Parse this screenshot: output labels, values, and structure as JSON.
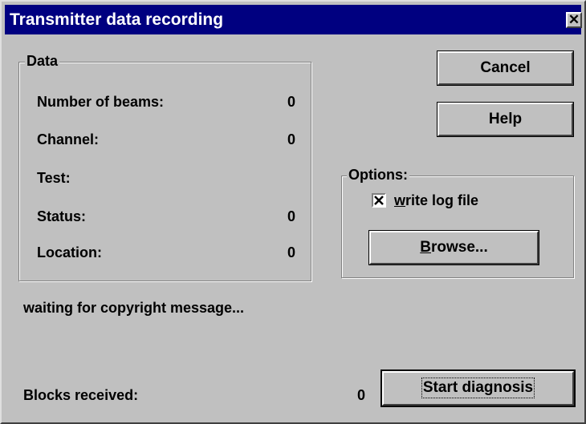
{
  "window": {
    "title": "Transmitter data recording",
    "close_glyph": "✕"
  },
  "data_group": {
    "label": "Data",
    "rows": [
      {
        "label": "Number of beams:",
        "value": "0"
      },
      {
        "label": "Channel:",
        "value": "0"
      },
      {
        "label": "Test:",
        "value": ""
      },
      {
        "label": "Status:",
        "value": "0"
      },
      {
        "label": "Location:",
        "value": "0"
      }
    ]
  },
  "status_message": "waiting for copyright message...",
  "blocks": {
    "label": "Blocks received:",
    "value": "0"
  },
  "buttons": {
    "cancel": "Cancel",
    "help": "Help",
    "browse_mnemonic": "B",
    "browse_rest": "rowse...",
    "start_diagnosis": "Start diagnosis"
  },
  "options_group": {
    "label": "Options:",
    "write_log_checked": true,
    "write_log_mnemonic": "w",
    "write_log_rest": "rite log file"
  },
  "colors": {
    "titlebar": "#000080",
    "face": "#c0c0c0"
  }
}
